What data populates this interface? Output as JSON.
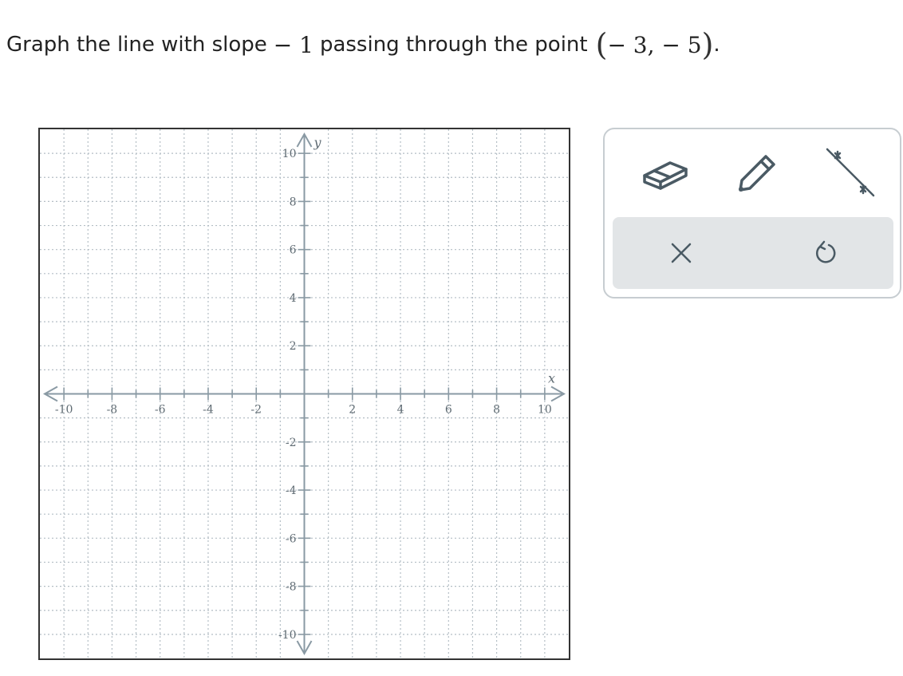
{
  "question": {
    "prefix": "Graph the line with slope",
    "slope": "− 1",
    "middle": "passing through the point",
    "open_paren": "(",
    "point": "− 3,  − 5",
    "close_paren": ")",
    "suffix": "."
  },
  "graph": {
    "x_axis_label": "x",
    "y_axis_label": "y",
    "x_min": -11,
    "x_max": 11,
    "y_min": -11,
    "y_max": 11,
    "tick_labels": [
      "-10",
      "-8",
      "-6",
      "-4",
      "-2",
      "2",
      "4",
      "6",
      "8",
      "10"
    ],
    "tick_values": [
      -10,
      -8,
      -6,
      -4,
      -2,
      2,
      4,
      6,
      8,
      10
    ],
    "minor_grid": "dotted",
    "major_grid_step": 1
  },
  "tools": {
    "eraser_icon": "eraser-icon",
    "pencil_icon": "pencil-icon",
    "line_icon": "line-tool-icon",
    "clear_icon": "close-icon",
    "undo_icon": "undo-icon"
  },
  "colors": {
    "axis": "#8a9aa4",
    "grid": "#b4bec5",
    "tick_label": "#5f6b73",
    "icon": "#4a5a64",
    "action_bar": "#e2e5e7"
  }
}
